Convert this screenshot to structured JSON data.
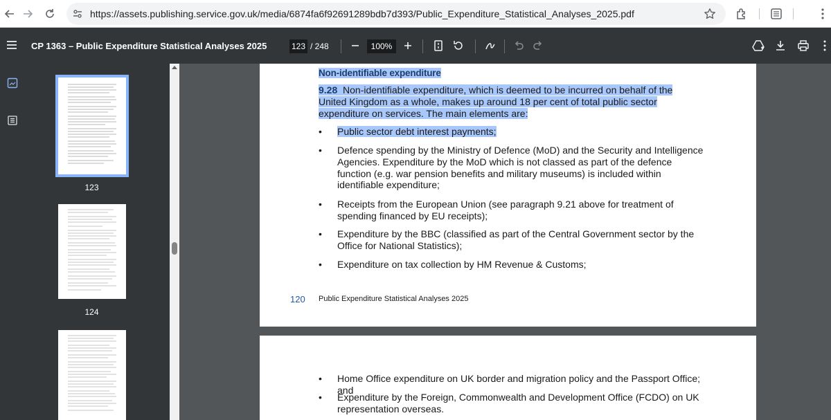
{
  "browser": {
    "url": "https://assets.publishing.service.gov.uk/media/6874fa6f92691289bdb7d393/Public_Expenditure_Statistical_Analyses_2025.pdf"
  },
  "pdf_toolbar": {
    "title": "CP 1363 – Public Expenditure Statistical Analyses 2025",
    "current_page": "123",
    "total_pages": "/ 248",
    "zoom": "100%"
  },
  "thumbnails": [
    {
      "label": "123"
    },
    {
      "label": "124"
    }
  ],
  "page1": {
    "heading": "Non-identifiable expenditure",
    "para_num": "9.28",
    "para_text": "Non-identifiable expenditure, which is deemed to be incurred on behalf of the United Kingdom as a whole, makes up around 18 per cent of total public sector expenditure on services. The main elements are:",
    "bullets": [
      "Public sector debt interest payments;",
      "Defence spending by the Ministry of Defence (MoD) and the Security and Intelligence Agencies. Expenditure by the MoD which is not classed as part of the defence function (e.g. war pension benefits and military museums) is included within identifiable expenditure;",
      "Receipts from the European Union (see paragraph 9.21 above for treatment of spending financed by EU receipts);",
      "Expenditure by the BBC (classified as part of the Central Government sector by the Office for National Statistics);",
      "Expenditure on tax collection by HM Revenue & Customs;"
    ],
    "bullet_char": "•",
    "footer_page": "120",
    "footer_title": "Public Expenditure Statistical Analyses 2025"
  },
  "page2": {
    "bullets": [
      "Home Office expenditure on UK border and migration policy and the Passport Office; and",
      "Expenditure by the Foreign, Commonwealth and Development Office (FCDO) on UK representation overseas."
    ]
  },
  "colors": {
    "toolbar": "#323639",
    "viewport": "#525659",
    "highlight": "#a8c7fa",
    "heading": "#1d3e6e",
    "thumb_selected": "#8ab4f8"
  }
}
